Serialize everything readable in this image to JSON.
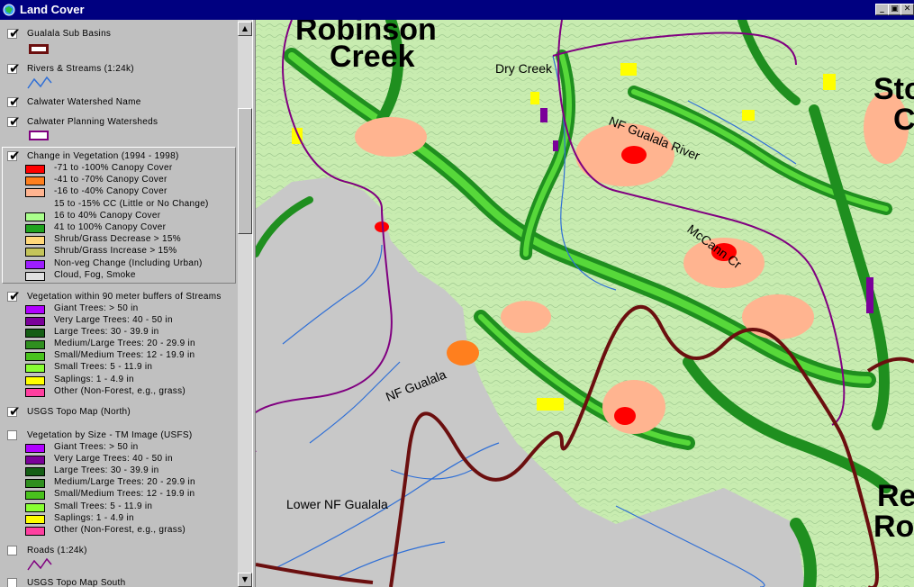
{
  "window": {
    "title": "Land Cover",
    "buttons": [
      "_",
      "▣",
      "✕"
    ]
  },
  "legend": {
    "themes": [
      {
        "name": "Gualala Sub Basins",
        "checked": true,
        "symbol": "box",
        "color": "#6b0f0f"
      },
      {
        "name": "Rivers & Streams (1:24k)",
        "checked": true,
        "symbol": "line",
        "color": "#2f6fd6"
      },
      {
        "name": "Calwater Watershed Name",
        "checked": true
      },
      {
        "name": "Calwater Planning Watersheds",
        "checked": true,
        "symbol": "box",
        "color": "#800080"
      },
      {
        "name": "Change in Vegetation (1994 - 1998)",
        "checked": true,
        "active": true,
        "classes": [
          {
            "label": "-71 to -100% Canopy Cover",
            "color": "#ff0000"
          },
          {
            "label": "-41 to -70% Canopy Cover",
            "color": "#ff7f1e"
          },
          {
            "label": "-16 to -40% Canopy Cover",
            "color": "#ffb490"
          },
          {
            "label": "15 to -15% CC (Little or No Change)",
            "color": ""
          },
          {
            "label": "16 to 40% Canopy Cover",
            "color": "#aaff8c"
          },
          {
            "label": "41 to 100% Canopy Cover",
            "color": "#1fa31f"
          },
          {
            "label": "Shrub/Grass Decrease > 15%",
            "color": "#ffd87a"
          },
          {
            "label": "Shrub/Grass Increase > 15%",
            "color": "#c4c45a"
          },
          {
            "label": "Non-veg Change (Including Urban)",
            "color": "#9d1dff"
          },
          {
            "label": "Cloud, Fog, Smoke",
            "color": "#e0e0e0"
          }
        ]
      },
      {
        "name": "Vegetation within 90 meter buffers of Streams",
        "checked": true,
        "classes": [
          {
            "label": "Giant Trees: > 50 in",
            "color": "#b000ff"
          },
          {
            "label": "Very Large Trees: 40 - 50 in",
            "color": "#7a0099"
          },
          {
            "label": "Large Trees: 30 - 39.9 in",
            "color": "#155e15"
          },
          {
            "label": "Medium/Large Trees: 20 - 29.9 in",
            "color": "#2f8f1f"
          },
          {
            "label": "Small/Medium Trees: 12 - 19.9 in",
            "color": "#49c21d"
          },
          {
            "label": "Small Trees: 5 - 11.9 in",
            "color": "#88ff33"
          },
          {
            "label": "Saplings: 1 - 4.9 in",
            "color": "#ffff00"
          },
          {
            "label": "Other (Non-Forest, e.g., grass)",
            "color": "#ff3fa0"
          }
        ]
      },
      {
        "name": "USGS Topo Map (North)",
        "checked": true
      },
      {
        "name": "Vegetation by Size - TM Image (USFS)",
        "checked": false,
        "classes": [
          {
            "label": "Giant Trees: > 50 in",
            "color": "#b000ff"
          },
          {
            "label": "Very Large Trees: 40 - 50 in",
            "color": "#7a0099"
          },
          {
            "label": "Large Trees: 30 - 39.9 in",
            "color": "#155e15"
          },
          {
            "label": "Medium/Large Trees: 20 - 29.9 in",
            "color": "#2f8f1f"
          },
          {
            "label": "Small/Medium Trees: 12 - 19.9 in",
            "color": "#49c21d"
          },
          {
            "label": "Small Trees: 5 - 11.9 in",
            "color": "#88ff33"
          },
          {
            "label": "Saplings: 1 - 4.9 in",
            "color": "#ffff00"
          },
          {
            "label": "Other (Non-Forest, e.g., grass)",
            "color": "#ff3fa0"
          }
        ]
      },
      {
        "name": "Roads (1:24k)",
        "checked": false,
        "symbol": "line",
        "color": "#800080"
      },
      {
        "name": "USGS Topo Map South",
        "checked": false
      }
    ]
  },
  "map": {
    "labels": {
      "robinson_1": "Robinson",
      "robinson_2": "Creek",
      "dry_creek": "Dry Creek",
      "nf_gualala_river": "NF Gualala River",
      "mccann": "McCann Cr",
      "nf_gualala": "NF Gualala",
      "lower_nf_gualala": "Lower NF Gualala",
      "ston_1": "Sto",
      "ston_2": "C",
      "re_1": "Re",
      "re_2": "Ro"
    },
    "colors": {
      "no_data": "#c8c8c8",
      "change_none": "#c8ecb0",
      "basin_boundary": "#6b0f0f",
      "watershed_boundary": "#800080",
      "stream": "#2f6fd6"
    }
  }
}
